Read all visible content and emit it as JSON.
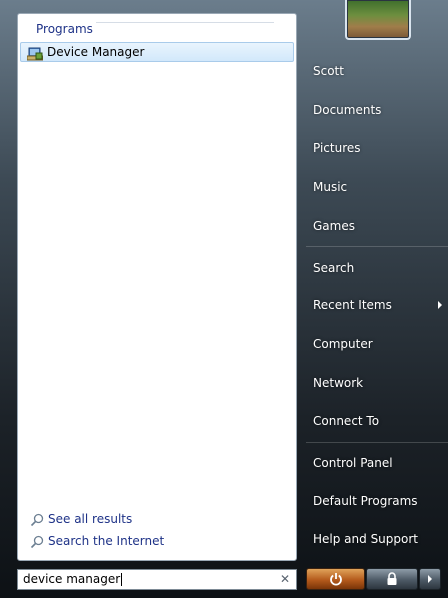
{
  "left_pane": {
    "group_header": "Programs",
    "results": [
      {
        "label": "Device Manager",
        "icon": "device-manager-icon"
      }
    ],
    "see_all": "See all results",
    "search_internet": "Search the Internet"
  },
  "search": {
    "value": "device manager"
  },
  "right_pane": {
    "items": [
      {
        "label": "Scott"
      },
      {
        "label": "Documents"
      },
      {
        "label": "Pictures"
      },
      {
        "label": "Music"
      },
      {
        "label": "Games"
      },
      {
        "label": "Search"
      },
      {
        "label": "Recent Items"
      },
      {
        "label": "Computer"
      },
      {
        "label": "Network"
      },
      {
        "label": "Connect To"
      },
      {
        "label": "Control Panel"
      },
      {
        "label": "Default Programs"
      },
      {
        "label": "Help and Support"
      }
    ]
  },
  "bottom_buttons": {
    "power": "power-icon",
    "lock": "lock-icon",
    "options": "arrow-right-icon"
  }
}
